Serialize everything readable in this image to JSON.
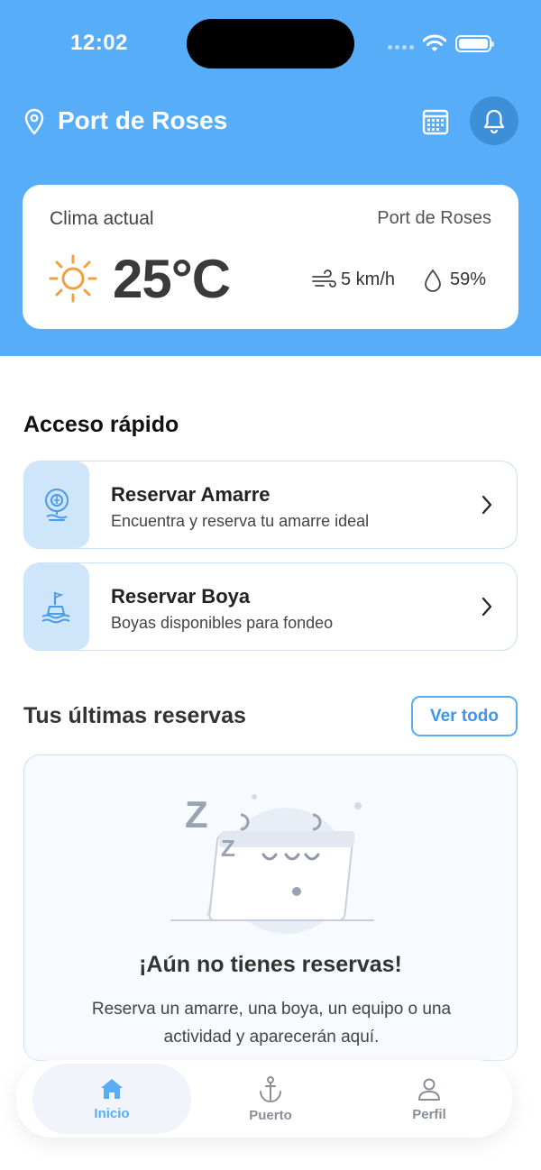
{
  "status_bar": {
    "time": "12:02"
  },
  "header": {
    "location": "Port de Roses"
  },
  "weather": {
    "title": "Clima actual",
    "place": "Port de Roses",
    "temperature": "25°C",
    "wind": "5 km/h",
    "humidity": "59%"
  },
  "quick_access": {
    "title": "Acceso rápido",
    "items": [
      {
        "title": "Reservar Amarre",
        "subtitle": "Encuentra y reserva tu amarre ideal",
        "icon": "berth-icon"
      },
      {
        "title": "Reservar Boya",
        "subtitle": "Boyas disponibles para fondeo",
        "icon": "buoy-icon"
      }
    ]
  },
  "reservations": {
    "title": "Tus últimas reservas",
    "view_all": "Ver todo",
    "empty_title": "¡Aún no tienes reservas!",
    "empty_desc": "Reserva un amarre, una boya, un equipo o una actividad y aparecerán aquí."
  },
  "tabs": [
    {
      "label": "Inicio",
      "icon": "home-icon",
      "active": true
    },
    {
      "label": "Puerto",
      "icon": "anchor-icon",
      "active": false
    },
    {
      "label": "Perfil",
      "icon": "person-icon",
      "active": false
    }
  ],
  "colors": {
    "primary": "#58adf8",
    "card_border": "#c9e1f7",
    "icon_bg": "#cfe5fa",
    "sun": "#f0a040"
  }
}
